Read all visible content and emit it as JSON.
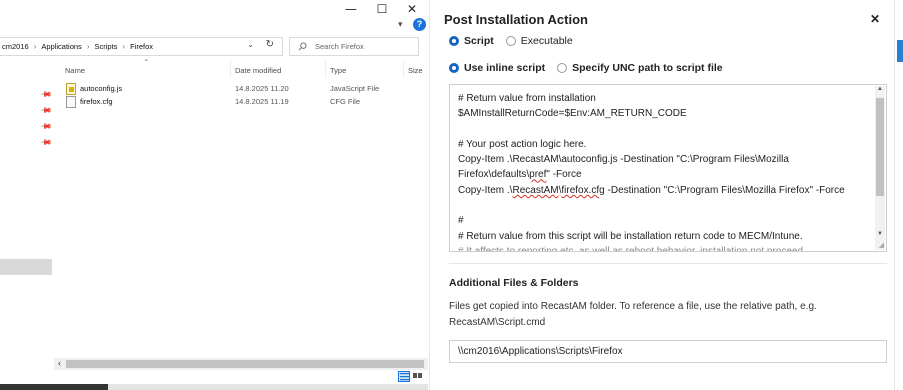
{
  "explorer": {
    "window_controls": {
      "minimize": "—",
      "maximize": "☐",
      "close": "✕"
    },
    "breadcrumb": [
      "cm2016",
      "Applications",
      "Scripts",
      "Firefox"
    ],
    "search": {
      "placeholder": "Search Firefox"
    },
    "columns": {
      "name": "Name",
      "date": "Date modified",
      "type": "Type",
      "size": "Size"
    },
    "files": [
      {
        "name": "autoconfig.js",
        "date": "14.8.2025 11.20",
        "type": "JavaScript File",
        "icon": "js-file-icon"
      },
      {
        "name": "firefox.cfg",
        "date": "14.8.2025 11.19",
        "type": "CFG File",
        "icon": "cfg-file-icon"
      }
    ]
  },
  "panel": {
    "title": "Post Installation Action",
    "close_glyph": "✕",
    "action_type": {
      "options": [
        "Script",
        "Executable"
      ],
      "selected": "Script"
    },
    "script_source": {
      "options": [
        "Use inline script",
        "Specify UNC path to script file"
      ],
      "selected": "Use inline script"
    },
    "script_lines": {
      "l1": "# Return value from installation",
      "l2": "$AMInstallReturnCode=$Env:AM_RETURN_CODE",
      "l3": "",
      "l4": "# Your post action logic here.",
      "l5": "Copy-Item .\\RecastAM\\autoconfig.js -Destination \"C:\\Program Files\\Mozilla",
      "l6a": "Firefox\\defaults\\",
      "l6b": "pref",
      "l6c": "\" -Force",
      "l7a": "Copy-Item .\\",
      "l7b": "RecastAM",
      "l7c": "\\",
      "l7d": "firefox.cfg",
      "l7e": " -Destination \"C:\\Program Files\\Mozilla Firefox\" -Force",
      "l8": "",
      "l9": "#",
      "l10": "# Return value from this script will be installation return code to MECM/Intune.",
      "l11": "# It affects to reporting etc. as well as reboot behavior, installation not proceed..."
    },
    "additional_files": {
      "title": "Additional Files & Folders",
      "help": "Files get copied into RecastAM folder. To reference a file, use the relative path, e.g. RecastAM\\Script.cmd",
      "path_value": "\\\\cm2016\\Applications\\Scripts\\Firefox"
    }
  },
  "colors": {
    "accent": "#1565c0",
    "help_blue": "#1a73d9",
    "error_underline": "#d93025"
  }
}
